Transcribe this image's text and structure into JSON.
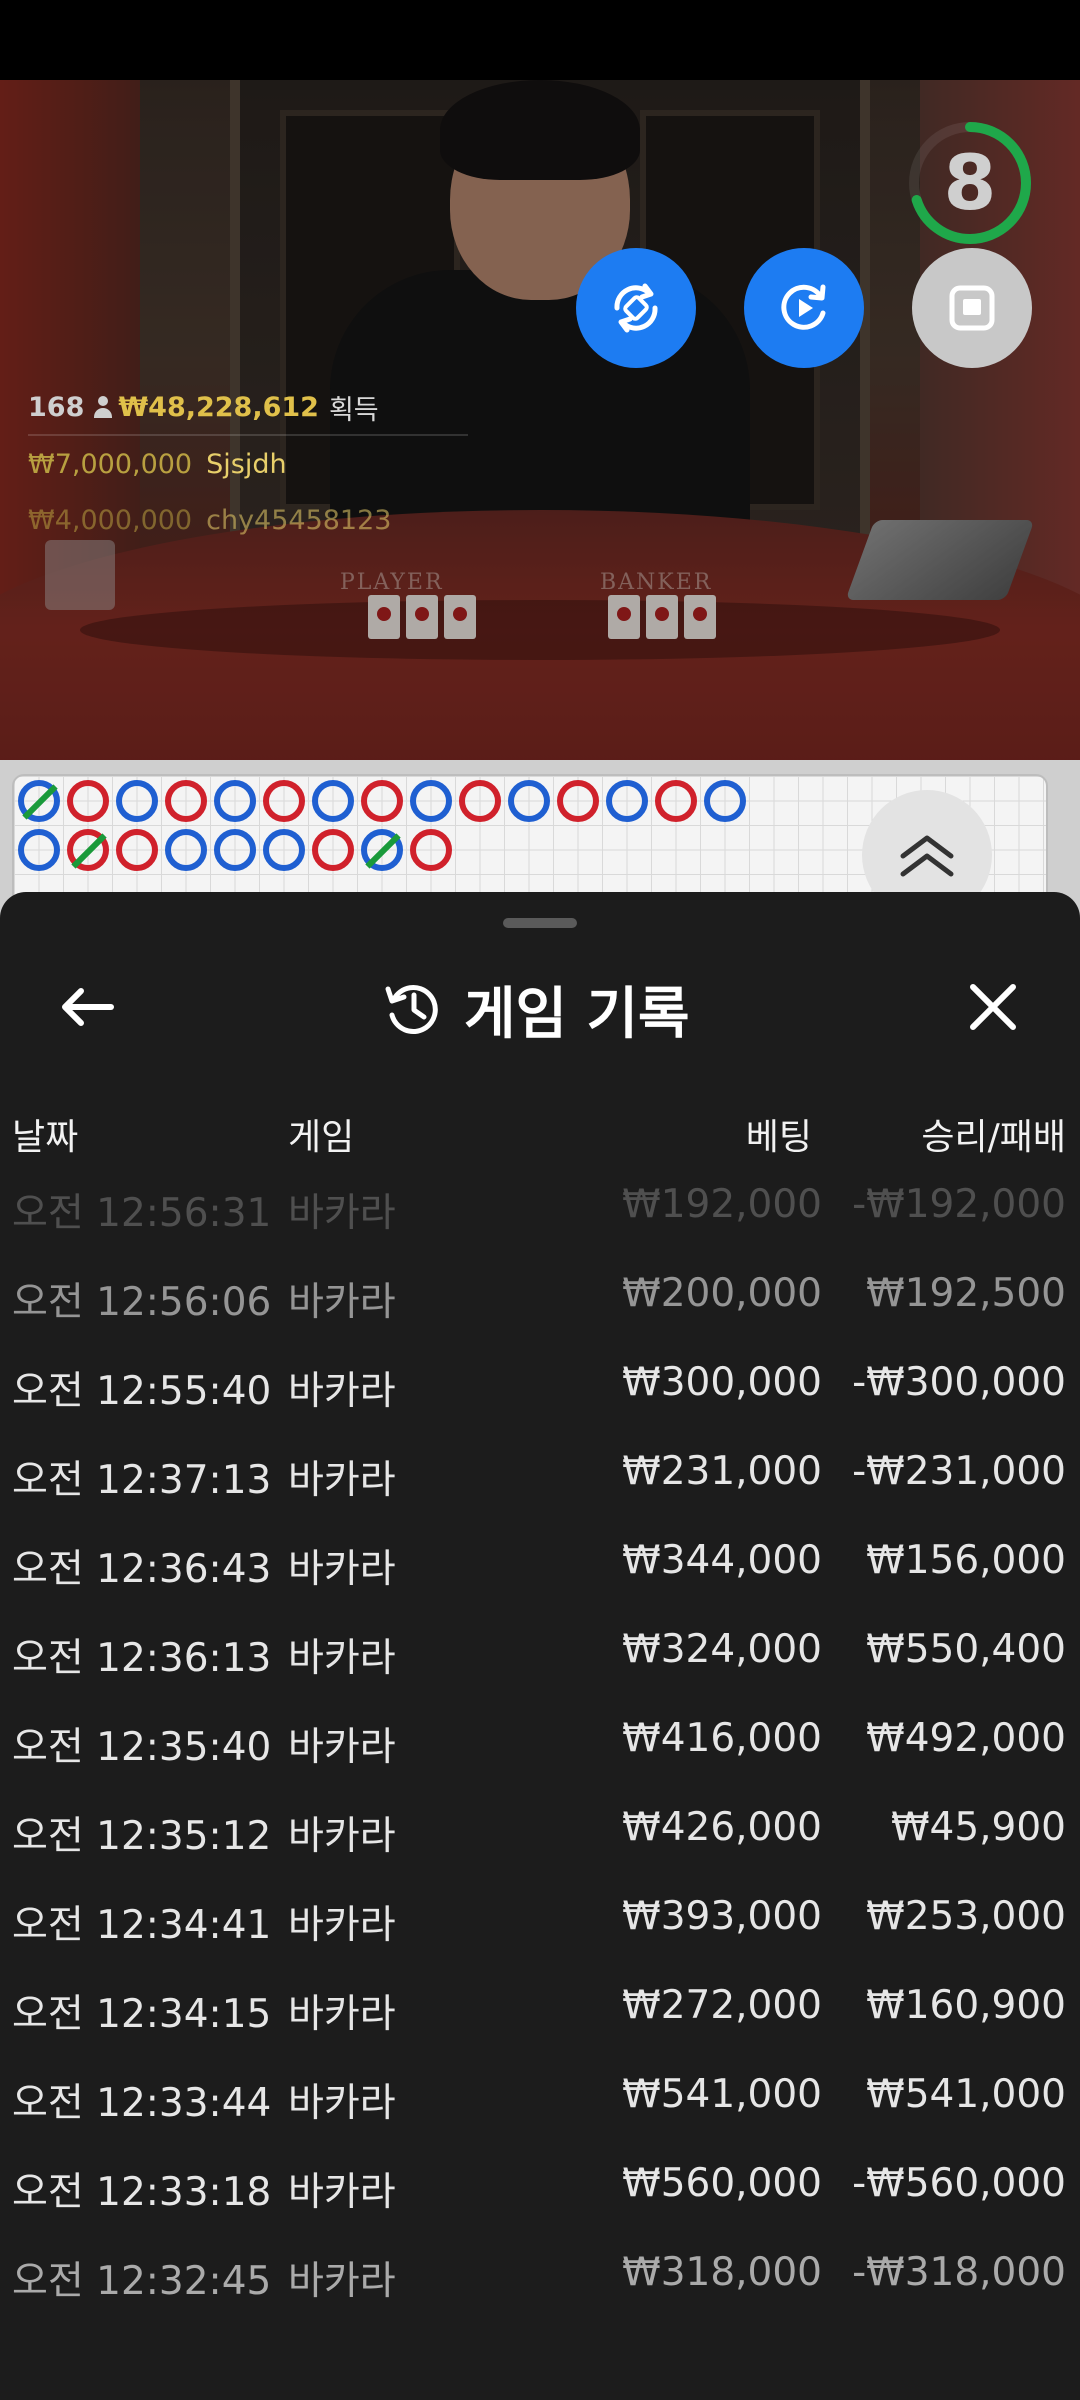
{
  "colors": {
    "accent_blue": "#1d7cf2",
    "gold": "#e0c04a",
    "sheet_bg": "#1c1c1c",
    "banker_red": "#d0212b",
    "player_blue": "#1f5fd1",
    "timer_green": "#1fa84a"
  },
  "video": {
    "timer": {
      "value": "8",
      "progress": 0.7
    },
    "table_labels": {
      "player": "PLAYER",
      "banker": "BANKER"
    },
    "controls": [
      {
        "name": "rotate-screen",
        "icon": "rotate-icon"
      },
      {
        "name": "replay",
        "icon": "replay-icon"
      },
      {
        "name": "stop",
        "icon": "stop-icon"
      }
    ],
    "winners": {
      "count": "168",
      "total": "₩48,228,612",
      "acquire_label": "획득",
      "list": [
        {
          "amount": "₩7,000,000",
          "name": "Sjsjdh"
        },
        {
          "amount": "₩4,000,000",
          "name": "chy45458123"
        }
      ]
    }
  },
  "roadmap": {
    "row1": [
      "b-slash",
      "r",
      "b",
      "r",
      "b",
      "r",
      "b",
      "r",
      "b",
      "r",
      "b",
      "r",
      "b",
      "r",
      "b"
    ],
    "row2": [
      "b",
      "r-slash",
      "r",
      "b",
      "b",
      "b",
      "r",
      "b-slash",
      "r"
    ]
  },
  "sheet": {
    "title": "게임 기록",
    "columns": {
      "date": "날짜",
      "game": "게임",
      "bet": "베팅",
      "result": "승리/패배"
    },
    "rows": [
      {
        "date": "오전 12:56:31",
        "game": "바카라",
        "bet": "₩192,000",
        "result": "-₩192,000"
      },
      {
        "date": "오전 12:56:06",
        "game": "바카라",
        "bet": "₩200,000",
        "result": "₩192,500"
      },
      {
        "date": "오전 12:55:40",
        "game": "바카라",
        "bet": "₩300,000",
        "result": "-₩300,000"
      },
      {
        "date": "오전 12:37:13",
        "game": "바카라",
        "bet": "₩231,000",
        "result": "-₩231,000"
      },
      {
        "date": "오전 12:36:43",
        "game": "바카라",
        "bet": "₩344,000",
        "result": "₩156,000"
      },
      {
        "date": "오전 12:36:13",
        "game": "바카라",
        "bet": "₩324,000",
        "result": "₩550,400"
      },
      {
        "date": "오전 12:35:40",
        "game": "바카라",
        "bet": "₩416,000",
        "result": "₩492,000"
      },
      {
        "date": "오전 12:35:12",
        "game": "바카라",
        "bet": "₩426,000",
        "result": "₩45,900"
      },
      {
        "date": "오전 12:34:41",
        "game": "바카라",
        "bet": "₩393,000",
        "result": "₩253,000"
      },
      {
        "date": "오전 12:34:15",
        "game": "바카라",
        "bet": "₩272,000",
        "result": "₩160,900"
      },
      {
        "date": "오전 12:33:44",
        "game": "바카라",
        "bet": "₩541,000",
        "result": "₩541,000"
      },
      {
        "date": "오전 12:33:18",
        "game": "바카라",
        "bet": "₩560,000",
        "result": "-₩560,000"
      },
      {
        "date": "오전 12:32:45",
        "game": "바카라",
        "bet": "₩318,000",
        "result": "-₩318,000"
      }
    ]
  }
}
